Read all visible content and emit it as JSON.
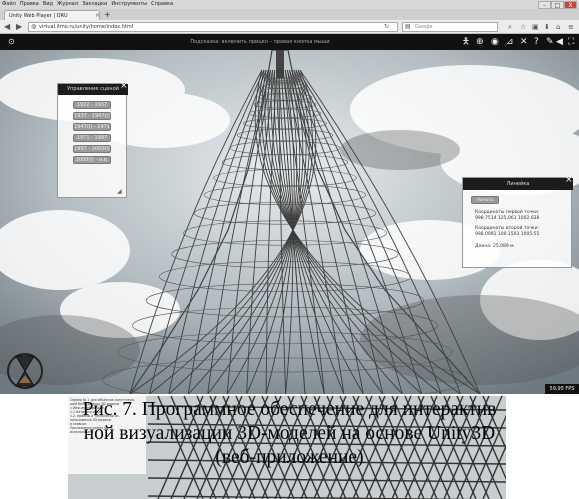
{
  "browser": {
    "menu": [
      "Файл",
      "Правка",
      "Вид",
      "Журнал",
      "Закладки",
      "Инструменты",
      "Справка"
    ],
    "tab_title": "Unity Web Player | ORU",
    "tab_close": "×",
    "new_tab": "+",
    "window_buttons": {
      "minimize": "–",
      "maximize": "□",
      "close": "X"
    },
    "url": "virtual.itmo.ru/unity/home/index.html",
    "search_placeholder": "Google"
  },
  "unity_toolbar": {
    "hint": "Подсказка: включить прицел – правая кнопка мыши"
  },
  "scene_panel": {
    "title": "Управление сценой",
    "close": "×",
    "periods": [
      "1922 - 1937",
      "1937 - 1947(I)",
      "1947(I) - 1971",
      "1971 - 1997",
      "1997 - 2000(I)",
      "2000(I) - н.в."
    ]
  },
  "ruler_panel": {
    "title": "Линейка",
    "close": "×",
    "start_button": "Начать",
    "first_point_label": "Координаты первой точки:",
    "first_point_value": "998.7514 125.061 1002.638",
    "second_point_label": "Координаты второй точки:",
    "second_point_value": "998.0091 100.1503 1005.55",
    "length_label": "Длина: 25.089 м."
  },
  "fps": "59.95 FPS",
  "document_snippet": [
    "Сервер № 1 для объектов сопутствую-",
    "щей базы данных 3D-модели",
    "с Web-интерфейсом",
    "",
    "1.1 Каталоги и т.п.",
    "1.2. приемы и технологии ис-",
    "пользования 3D-модели",
    "в сервисе",
    "Приложение может быть",
    "использовано"
  ],
  "caption": {
    "line1": "Рис. 7. Программное обеспечение для интерактив",
    "line2": "ной визуализации 3D-моделей на основе Unity3D",
    "line3": "(веб-приложение)"
  }
}
